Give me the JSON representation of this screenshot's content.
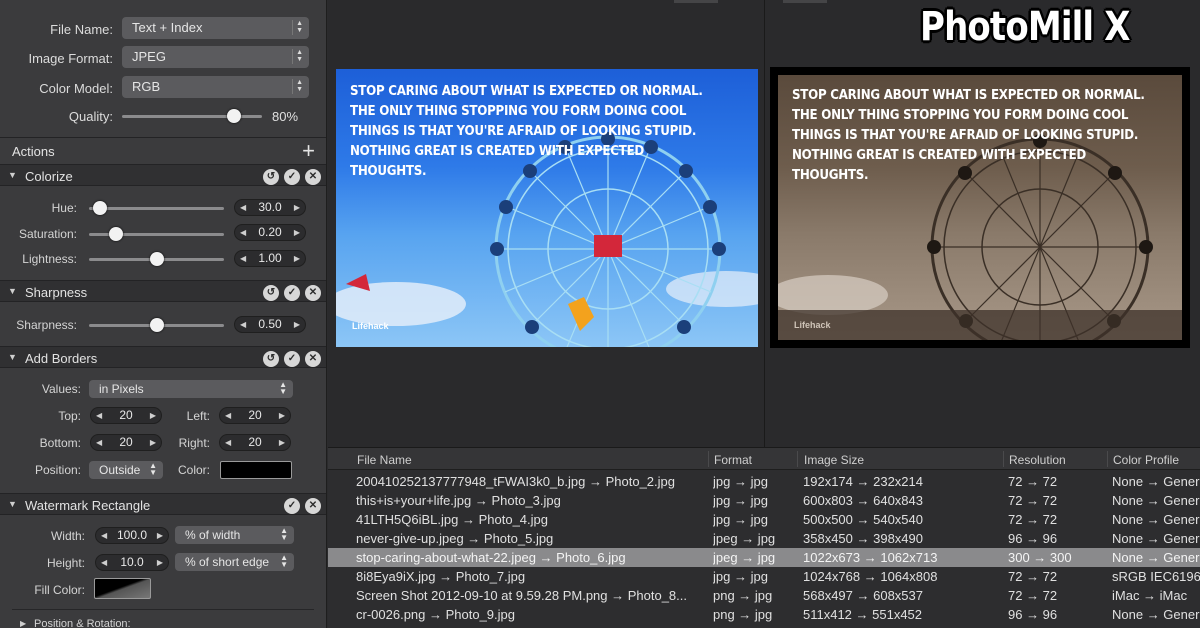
{
  "brand": "PhotoMill X",
  "output": {
    "file_name_label": "File Name:",
    "file_name_value": "Text + Index",
    "image_format_label": "Image Format:",
    "image_format_value": "JPEG",
    "color_model_label": "Color Model:",
    "color_model_value": "RGB",
    "quality_label": "Quality:",
    "quality_value": "80%",
    "quality_fraction": 0.8
  },
  "actions": {
    "title": "Actions",
    "add_symbol": "+"
  },
  "colorize": {
    "title": "Colorize",
    "hue_label": "Hue:",
    "hue_value": "30.0",
    "hue_fraction": 0.08,
    "saturation_label": "Saturation:",
    "saturation_value": "0.20",
    "saturation_fraction": 0.2,
    "lightness_label": "Lightness:",
    "lightness_value": "1.00",
    "lightness_fraction": 0.5
  },
  "sharpness": {
    "title": "Sharpness",
    "sharpness_label": "Sharpness:",
    "sharpness_value": "0.50",
    "sharpness_fraction": 0.5
  },
  "borders": {
    "title": "Add Borders",
    "values_label": "Values:",
    "values_value": "in Pixels",
    "top_label": "Top:",
    "top_value": "20",
    "left_label": "Left:",
    "left_value": "20",
    "bottom_label": "Bottom:",
    "bottom_value": "20",
    "right_label": "Right:",
    "right_value": "20",
    "position_label": "Position:",
    "position_value": "Outside",
    "color_label": "Color:",
    "color_hex": "#000000"
  },
  "watermark": {
    "title": "Watermark Rectangle",
    "width_label": "Width:",
    "width_value": "100.0",
    "width_unit": "% of width",
    "height_label": "Height:",
    "height_value": "10.0",
    "height_unit": "% of short edge",
    "fill_label": "Fill Color:"
  },
  "position_rotation": {
    "title": "Position & Rotation:"
  },
  "preview": {
    "quote": "Stop caring about what is expected or normal. The only thing stopping you form doing cool things is that you're afraid of looking stupid. Nothing great is created with expected thoughts.",
    "credit": "Lifehack"
  },
  "table": {
    "headers": {
      "file_name": "File Name",
      "format": "Format",
      "image_size": "Image Size",
      "resolution": "Resolution",
      "color_profile": "Color Profile"
    },
    "rows": [
      {
        "file": "20041025213777794­8_tFWAI3k0_b.jpg → Photo_2.jpg",
        "format": "jpg → jpg",
        "size": "192x174 → 232x214",
        "res": "72 → 72",
        "profile": "None → Gener"
      },
      {
        "file": "this+is+your+life.jpg → Photo_3.jpg",
        "format": "jpg → jpg",
        "size": "600x803 → 640x843",
        "res": "72 → 72",
        "profile": "None → Gener"
      },
      {
        "file": "41LTH5Q6iBL.jpg → Photo_4.jpg",
        "format": "jpg → jpg",
        "size": "500x500 → 540x540",
        "res": "72 → 72",
        "profile": "None → Gener"
      },
      {
        "file": "never-give-up.jpeg → Photo_5.jpg",
        "format": "jpeg → jpg",
        "size": "358x450 → 398x490",
        "res": "96 → 96",
        "profile": "None → Gener"
      },
      {
        "file": "stop-caring-about-what-22.jpeg → Photo_6.jpg",
        "format": "jpeg → jpg",
        "size": "1022x673 → 1062x713",
        "res": "300 → 300",
        "profile": "None → Gener"
      },
      {
        "file": "8i8Eya9iX.jpg → Photo_7.jpg",
        "format": "jpg → jpg",
        "size": "1024x768 → 1064x808",
        "res": "72 → 72",
        "profile": "sRGB IEC6196"
      },
      {
        "file": "Screen Shot 2012-09-10 at 9.59.28 PM.png → Photo_8...",
        "format": "png → jpg",
        "size": "568x497 → 608x537",
        "res": "72 → 72",
        "profile": "iMac → iMac"
      },
      {
        "file": "cr-0026.png → Photo_9.jpg",
        "format": "png → jpg",
        "size": "511x412 → 551x452",
        "res": "96 → 96",
        "profile": "None → Gener"
      }
    ]
  }
}
